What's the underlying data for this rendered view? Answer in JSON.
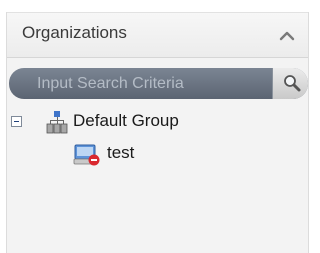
{
  "panel": {
    "title": "Organizations",
    "collapse_icon": "chevron-up-icon"
  },
  "search": {
    "placeholder": "Input Search Criteria",
    "value": "",
    "button_icon": "search-icon"
  },
  "tree": {
    "root": {
      "label": "Default Group",
      "icon": "organization-group-icon",
      "expanded": true
    },
    "children": [
      {
        "label": "test",
        "icon": "device-offline-icon"
      }
    ]
  },
  "colors": {
    "search_bar": "#6a7380",
    "panel_bg": "#f3f3f3",
    "offline_badge": "#d9282f"
  }
}
